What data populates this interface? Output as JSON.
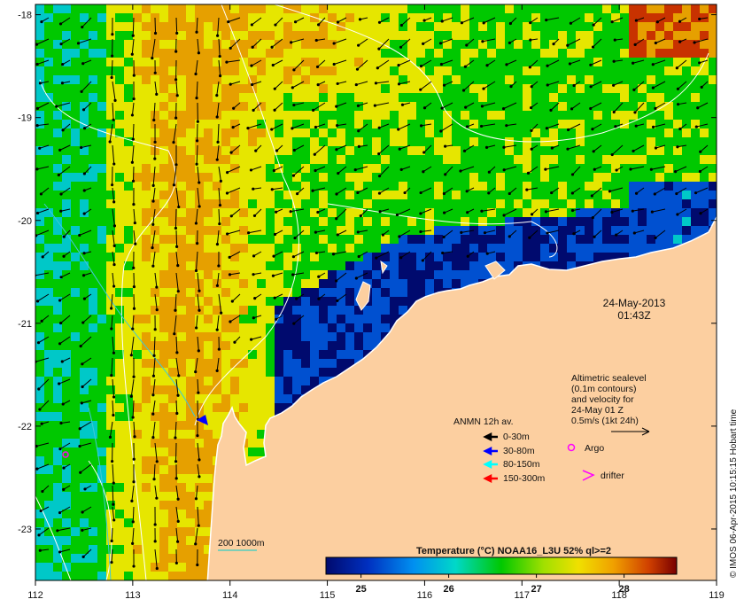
{
  "map": {
    "lon_ticks": [
      "112",
      "113",
      "114",
      "115",
      "116",
      "117",
      "118",
      "119"
    ],
    "lat_ticks": [
      "-18",
      "-19",
      "-20",
      "-21",
      "-22",
      "-23"
    ],
    "lon_range": [
      112,
      119
    ],
    "lat_range": [
      -23.5,
      -17.9
    ],
    "land_color": "#fccfa0",
    "ocean_palette": [
      "#000a6e",
      "#0050d0",
      "#00c8c8",
      "#00c800",
      "#e6e600",
      "#e6a000",
      "#c83200",
      "#780000"
    ]
  },
  "date_label": {
    "date": "24-May-2013",
    "time": "01:43Z"
  },
  "sealevel_note": {
    "lines": [
      "Altimetric sealevel",
      "(0.1m contours)",
      "and velocity for",
      "24-May 01 Z",
      "0.5m/s (1kt 24h)"
    ]
  },
  "legend": {
    "title": "ANMN 12h av.",
    "items": [
      {
        "label": "0-30m",
        "color": "#000000"
      },
      {
        "label": "30-80m",
        "color": "#0000ff"
      },
      {
        "label": "80-150m",
        "color": "#00ffff"
      },
      {
        "label": "150-300m",
        "color": "#ff0000"
      }
    ],
    "argo_label": "Argo",
    "drifter_label": "drifter",
    "argo_color": "#ff00ff",
    "drifter_color": "#ff00ff"
  },
  "scale": {
    "label": "200  1000m"
  },
  "colorbar": {
    "title": "Temperature (°C) NOAA16_L3U 52% ql>=2",
    "ticks": [
      "25",
      "26",
      "27",
      "28"
    ],
    "tick_values": [
      25,
      26,
      27,
      28
    ],
    "range": [
      24.6,
      28.6
    ]
  },
  "credit": "© IMOS 06-Apr-2015 10:15:15 Hobart time"
}
